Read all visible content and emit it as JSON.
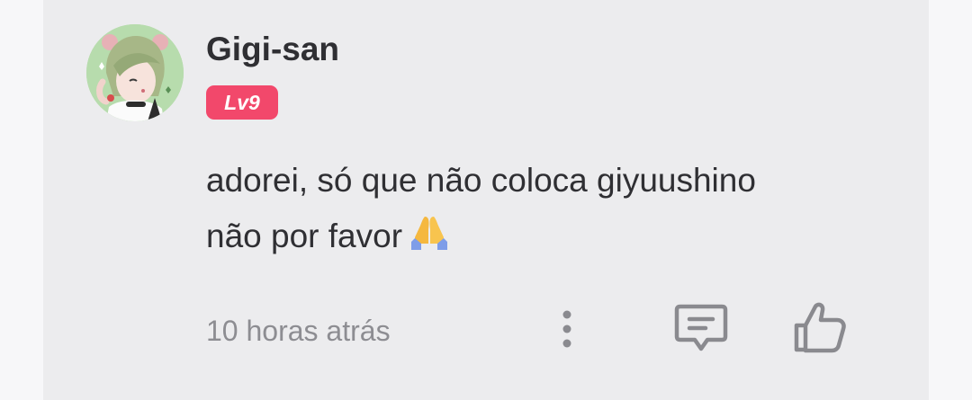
{
  "comment": {
    "username": "Gigi-san",
    "level": "Lv9",
    "text_line1": "adorei, só que não coloca giyuushino",
    "text_line2": "não por favor",
    "emoji": "folded-hands-icon",
    "timestamp": "10 horas atrás"
  },
  "actions": {
    "more": "more-options-icon",
    "reply": "reply-comment-icon",
    "like": "thumbs-up-icon"
  },
  "colors": {
    "background": "#ececee",
    "badge": "#f2486b",
    "text": "#2f2f33",
    "muted": "#8d8d92",
    "icon": "#8a8a8f"
  }
}
